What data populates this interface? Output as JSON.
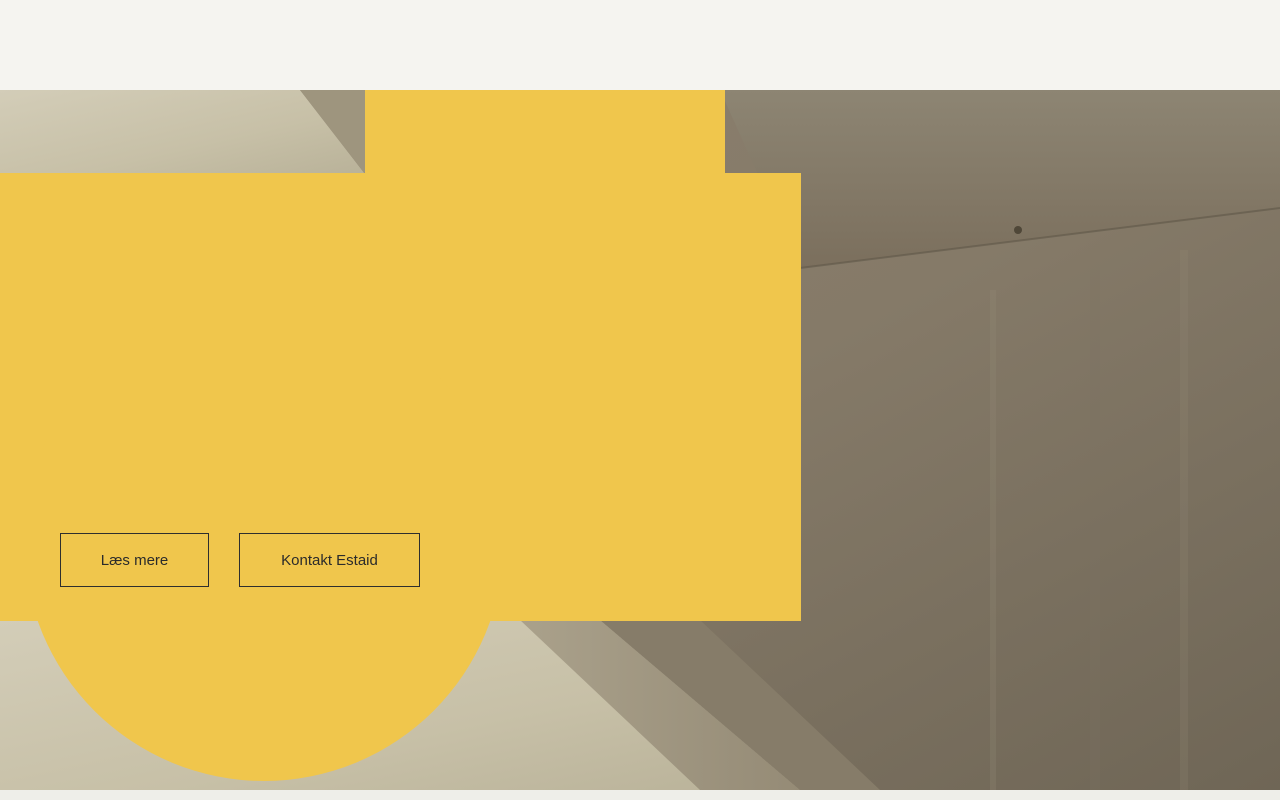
{
  "colors": {
    "accent": "#f0c64c",
    "background": "#f5f4f0"
  },
  "hero": {
    "buttons": {
      "read_more_label": "Læs mere",
      "contact_label": "Kontakt Estaid"
    }
  }
}
